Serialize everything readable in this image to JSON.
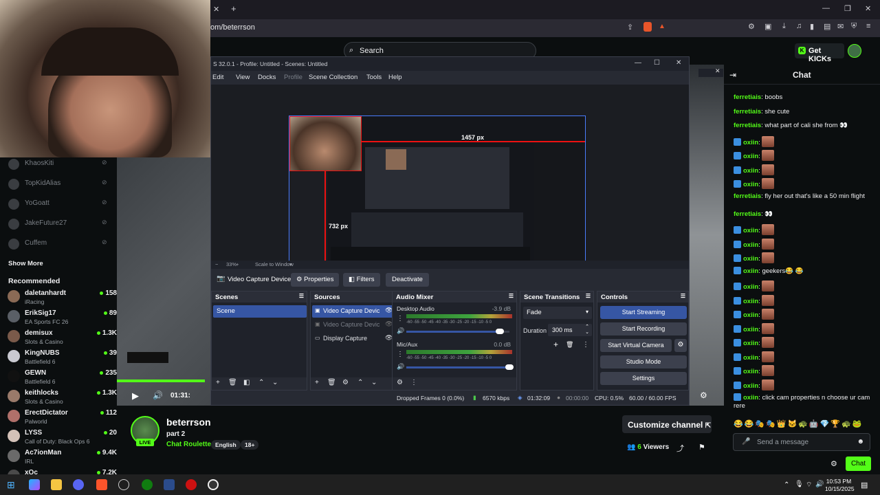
{
  "browser": {
    "url": "om/beterrson",
    "close_tab": "✕",
    "new_tab": "+"
  },
  "kick": {
    "search_placeholder": "Search",
    "get_kicks": "Get KICKs"
  },
  "sidebar": {
    "following": [
      {
        "name": "KhaosKiti"
      },
      {
        "name": "TopKidAlias"
      },
      {
        "name": "YoGoatt"
      },
      {
        "name": "JakeFuture27"
      },
      {
        "name": "Cuffem"
      }
    ],
    "show_more": "Show More",
    "recommended_title": "Recommended",
    "recommended": [
      {
        "name": "daletanhardt",
        "category": "iRacing",
        "viewers": "158",
        "color": "#8a6a55"
      },
      {
        "name": "ErikSig17",
        "category": "EA Sports FC 26",
        "viewers": "89",
        "color": "#5a5f66"
      },
      {
        "name": "demisux",
        "category": "Slots & Casino",
        "viewers": "1.3K",
        "color": "#7a5a4a"
      },
      {
        "name": "KingNUBS",
        "category": "Battlefield 6",
        "viewers": "39",
        "color": "#c9c9d1"
      },
      {
        "name": "GEWN",
        "category": "Battlefield 6",
        "viewers": "235",
        "color": "#111111"
      },
      {
        "name": "keithlocks",
        "category": "Slots & Casino",
        "viewers": "1.3K",
        "color": "#9a7a6a"
      },
      {
        "name": "ErectDictator",
        "category": "Palworld",
        "viewers": "112",
        "color": "#b0706a"
      },
      {
        "name": "LYSS",
        "category": "Call of Duty: Black Ops 6",
        "viewers": "20",
        "color": "#d4c2b8"
      },
      {
        "name": "Ac7ionMan",
        "category": "IRL",
        "viewers": "9.4K",
        "color": "#6a6a6a"
      },
      {
        "name": "xQc",
        "category": "",
        "viewers": "7.2K",
        "color": "#4a4a4a"
      }
    ]
  },
  "obs": {
    "title": "S 32.0.1 - Profile: Untitled - Scenes: Untitled",
    "menu": [
      "Edit",
      "View",
      "Docks",
      "Profile",
      "Scene Collection",
      "Tools",
      "Help"
    ],
    "measure_width": "1457 px",
    "measure_height": "732 px",
    "zoom": "33%",
    "scale_mode": "Scale to Window",
    "selected_source": "Video Capture Device 2",
    "properties_btn": "Properties",
    "filters_btn": "Filters",
    "deactivate_btn": "Deactivate",
    "scenes_title": "Scenes",
    "scenes": [
      "Scene"
    ],
    "sources_title": "Sources",
    "sources": [
      "Video Capture Devic",
      "Video Capture Devic",
      "Display Capture"
    ],
    "mixer_title": "Audio Mixer",
    "mixer": [
      {
        "name": "Desktop Audio",
        "db": "-3.9 dB",
        "level": 0.9
      },
      {
        "name": "Mic/Aux",
        "db": "0.0 dB",
        "level": 1.0
      }
    ],
    "meter_scale": "-60 -55 -50 -45 -40 -35 -30 -25 -20 -15 -10 -5 0",
    "transitions_title": "Scene Transitions",
    "transition": "Fade",
    "duration_label": "Duration",
    "duration_value": "300 ms",
    "controls_title": "Controls",
    "controls": [
      "Start Streaming",
      "Start Recording",
      "Start Virtual Camera",
      "Studio Mode",
      "Settings"
    ],
    "status": {
      "dropped": "Dropped Frames 0 (0.0%)",
      "kbps": "6570 kbps",
      "live_time": "01:32:09",
      "rec_time": "00:00:00",
      "cpu": "CPU: 0.5%",
      "fps": "60.00 / 60.00 FPS"
    }
  },
  "player": {
    "time": "01:31:"
  },
  "channel": {
    "name": "beterrson",
    "title": "part 2",
    "category": "Chat Roulette",
    "tags": [
      "English",
      "18+"
    ],
    "live_badge": "LIVE",
    "customize": "Customize channel",
    "viewers_count": "6",
    "viewers_label": "Viewers"
  },
  "chat": {
    "title": "Chat",
    "messages": [
      {
        "user": "ferretiais",
        "text": "boobs",
        "emote": false,
        "badge": false
      },
      {
        "user": "ferretiais",
        "text": "she cute",
        "emote": false,
        "badge": false
      },
      {
        "user": "ferretiais",
        "text": "what part of cali she from 👀",
        "emote": false,
        "badge": false
      },
      {
        "user": "oxiin",
        "text": "",
        "emote": true,
        "badge": true
      },
      {
        "user": "oxiin",
        "text": "",
        "emote": true,
        "badge": true
      },
      {
        "user": "oxiin",
        "text": "",
        "emote": true,
        "badge": true
      },
      {
        "user": "oxiin",
        "text": "",
        "emote": true,
        "badge": true
      },
      {
        "user": "ferretiais",
        "text": "fly her out that's like a 50 min flight",
        "emote": false,
        "badge": false
      },
      {
        "user": "ferretiais",
        "text": "👀",
        "emote": false,
        "badge": false
      },
      {
        "user": "oxiin",
        "text": "",
        "emote": true,
        "badge": true
      },
      {
        "user": "oxiin",
        "text": "",
        "emote": true,
        "badge": true
      },
      {
        "user": "oxiin",
        "text": "",
        "emote": true,
        "badge": true
      },
      {
        "user": "oxiin",
        "text": "geekers😂 😂",
        "emote": false,
        "badge": true
      },
      {
        "user": "oxiin",
        "text": "",
        "emote": true,
        "badge": true
      },
      {
        "user": "oxiin",
        "text": "",
        "emote": true,
        "badge": true
      },
      {
        "user": "oxiin",
        "text": "",
        "emote": true,
        "badge": true
      },
      {
        "user": "oxiin",
        "text": "",
        "emote": true,
        "badge": true
      },
      {
        "user": "oxiin",
        "text": "",
        "emote": true,
        "badge": true
      },
      {
        "user": "oxiin",
        "text": "",
        "emote": true,
        "badge": true
      },
      {
        "user": "oxiin",
        "text": "",
        "emote": true,
        "badge": true
      },
      {
        "user": "oxiin",
        "text": "",
        "emote": true,
        "badge": true
      },
      {
        "user": "oxiin",
        "text": "click cam properties n choose ur cam rere",
        "emote": false,
        "badge": true
      }
    ],
    "input_placeholder": "Send a message",
    "send_button": "Chat"
  },
  "taskbar": {
    "time": "10:53 PM",
    "date": "10/15/2025"
  }
}
